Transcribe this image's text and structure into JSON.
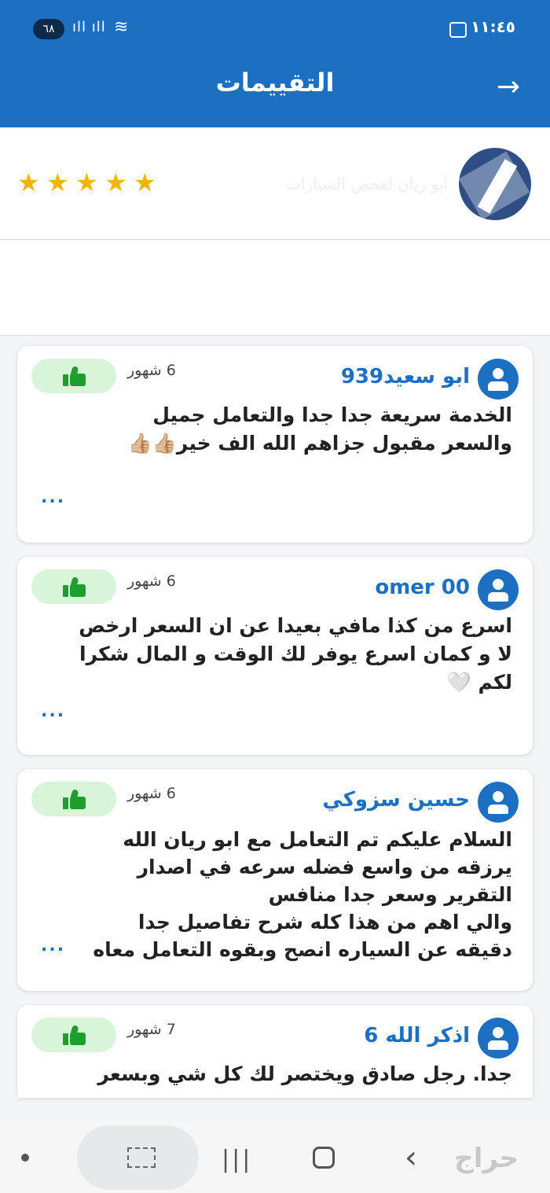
{
  "status_bar": {
    "time": "١١:٤٥",
    "battery": "٦٨"
  },
  "app_bar": {
    "title": "التقييمات",
    "back_icon": "arrow-right-icon"
  },
  "shop": {
    "name": "أبو ريان لفحص السيارات",
    "rating_stars": 5
  },
  "reviews": [
    {
      "name": "ابو سعيد939",
      "time": "6 شهور",
      "text_lines": [
        "الخدمة سريعة جدا  جدا  والتعامل جميل",
        "والسعر مقبول جزاهم الله الف خير👍🏼👍🏼"
      ],
      "more": "..."
    },
    {
      "name": "omer 00",
      "time": "6 شهور",
      "text_lines": [
        "اسرع من كذا مافي بعيدا عن ان السعر ارخص",
        "لا و كمان اسرع يوفر لك الوقت و المال شكرا",
        "لكم 🤍"
      ],
      "more": "..."
    },
    {
      "name": "حسين سزوكي",
      "time": "6 شهور",
      "text_lines": [
        "السلام عليكم تم التعامل مع ابو ريان الله",
        "يرزقه من واسع فضله سرعه في اصدار",
        "التقرير وسعر جدا منافس",
        "والي اهم من هذا كله شرح تفاصيل جدا",
        "دقيقه عن السياره انصح وبقوه التعامل معاه"
      ],
      "more": "..."
    },
    {
      "name": "اذكر الله 6",
      "time": "7 شهور",
      "text_lines": [
        "جدا. رجل صادق ويختصر لك كل شي وبسعر"
      ],
      "more": ""
    }
  ],
  "nav": {
    "watermark": "حراج"
  }
}
